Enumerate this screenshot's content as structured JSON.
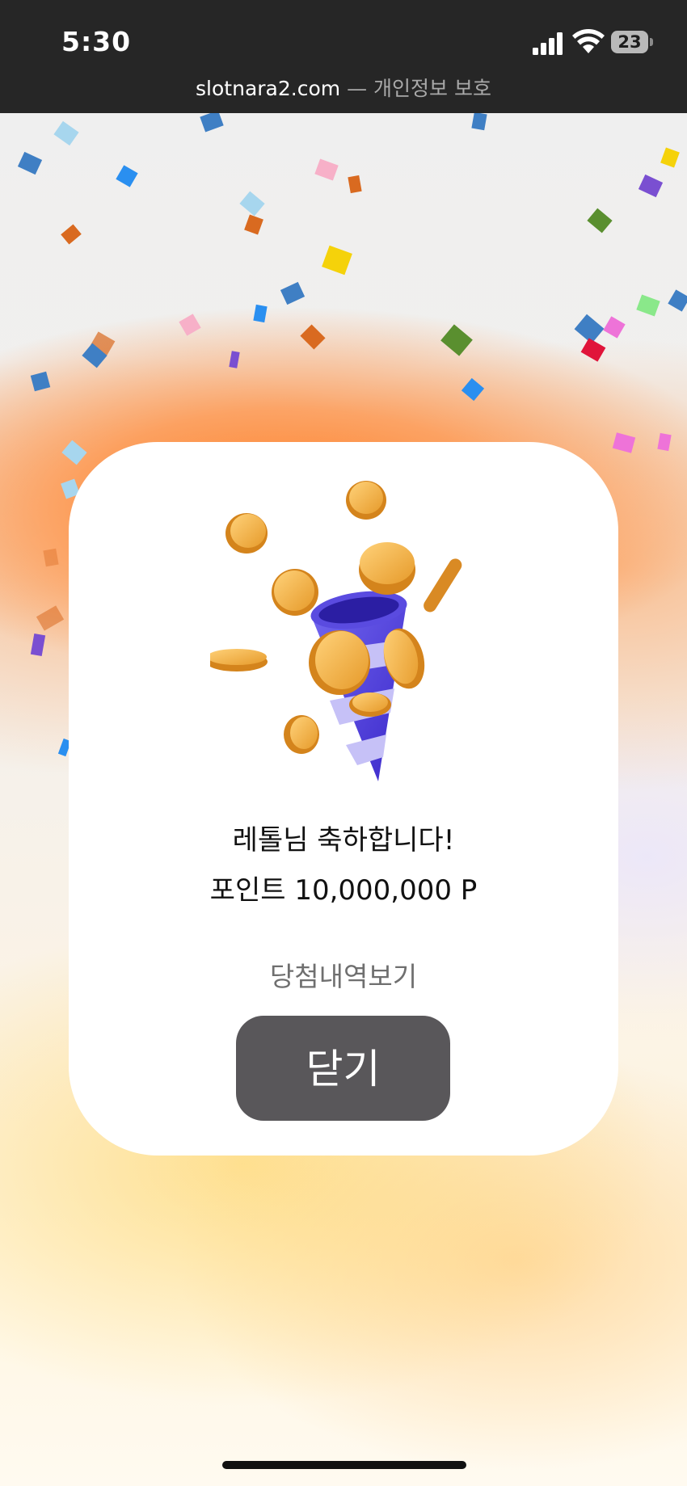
{
  "status_bar": {
    "time": "5:30",
    "battery_level": "23",
    "url": "slotnara2.com",
    "separator": "—",
    "privacy_label": "개인정보 보호"
  },
  "modal": {
    "congrats_text": "레톨님 축하합니다!",
    "points_text": "포인트 10,000,000 P",
    "history_link": "당첨내역보기",
    "close_label": "닫기"
  },
  "colors": {
    "status_bar_bg": "#262626",
    "accent_orange": "#ff8a30",
    "close_button_bg": "#59575a",
    "link_gray": "#6f6f6f"
  },
  "icons": [
    "signal-icon",
    "wifi-icon",
    "battery-icon",
    "coins-party-popper-icon"
  ]
}
